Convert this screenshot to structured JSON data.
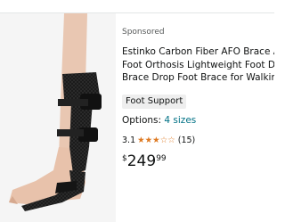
{
  "product": {
    "sponsored_label": "Sponsored",
    "title_lines": [
      "Estinko Carbon Fiber AFO Brace Ankle",
      "Foot Orthosis Lightweight Foot Drop",
      "Brace Drop Foot Brace for Walking..."
    ],
    "badge": "Foot Support",
    "options_label": "Options:",
    "options_link": "4 sizes",
    "rating": "3.1",
    "stars": "3.1 of 5",
    "review_count": "(15)",
    "price": {
      "symbol": "$",
      "whole": "249",
      "fraction": "99"
    }
  },
  "colors": {
    "link": "#007185",
    "star": "#de7921",
    "text": "#0f1111",
    "muted": "#565959"
  },
  "icons": {
    "brace_image": "carbon-fiber-afo-brace-product-image",
    "star": "star-icon"
  }
}
